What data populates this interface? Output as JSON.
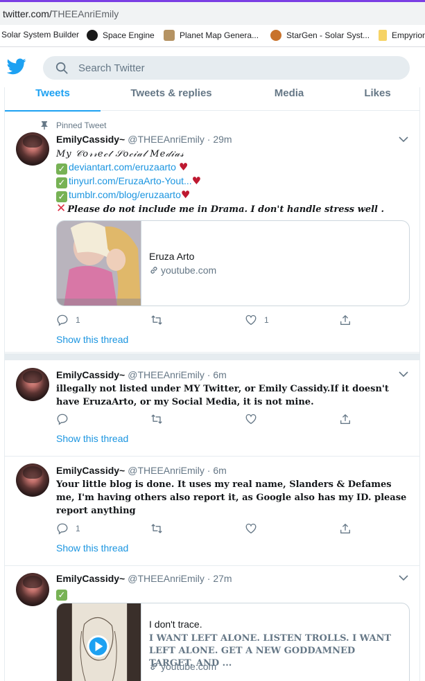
{
  "browser": {
    "url_host": "twitter.com/",
    "url_path": "THEEAnriEmily",
    "bookmarks": [
      {
        "label": "Solar System Builder",
        "icon": "none"
      },
      {
        "label": "Space Engine",
        "icon": "space-engine-icon",
        "color": "#1a1a1a"
      },
      {
        "label": "Planet Map Genera...",
        "icon": "planet-map-icon",
        "color": "#8a6a3a"
      },
      {
        "label": "StarGen - Solar Syst...",
        "icon": "stargen-icon",
        "color": "#c8722b"
      },
      {
        "label": "Empyrion",
        "icon": "folder-icon",
        "color": "#f6d365"
      }
    ]
  },
  "twitter": {
    "search_placeholder": "Search Twitter",
    "brand_color": "#1da1f2",
    "tabs": [
      {
        "label": "Tweets",
        "active": true
      },
      {
        "label": "Tweets & replies",
        "active": false
      },
      {
        "label": "Media",
        "active": false
      },
      {
        "label": "Likes",
        "active": false
      }
    ],
    "tweets": [
      {
        "pinned_label": "Pinned Tweet",
        "name": "EmilyCassidy~",
        "handle": "@THEEAnriEmily",
        "time": "· 29m",
        "line1": "𝑀𝑦 𝒞𝑜𝓇𝓇𝑒𝒸𝓉 𝒮𝑜𝒸𝒾𝒶𝓁 𝑀𝑒𝒹𝒾𝒶𝓈",
        "links": [
          "deviantart.com/eruzaarto",
          "tinyurl.com/EruzaArto-Yout...",
          "tumblr.com/blog/eruzaarto"
        ],
        "warning": "Please do not include me in Drama. I don't handle stress well .",
        "card": {
          "title": "Eruza Arto",
          "domain": "youtube.com"
        },
        "reply_count": "1",
        "like_count": "1",
        "show_thread": "Show this thread"
      },
      {
        "name": "EmilyCassidy~",
        "handle": "@THEEAnriEmily",
        "time": "· 6m",
        "text": "illegally not listed under MY Twitter, or Emily Cassidy.If it doesn't have EruzaArto, or my Social Media, it is not mine.",
        "show_thread": "Show this thread"
      },
      {
        "name": "EmilyCassidy~",
        "handle": "@THEEAnriEmily",
        "time": "· 6m",
        "text": "Your little blog is done. It uses my real name, Slanders & Defames me, I'm having others also report it, as  Google also has my ID. please report anything",
        "reply_count": "1",
        "show_thread": "Show this thread"
      },
      {
        "name": "EmilyCassidy~",
        "handle": "@THEEAnriEmily",
        "time": "· 27m",
        "card": {
          "title": "I don't trace.",
          "description": "I WANT LEFT ALONE. LISTEN TROLLS. I WANT LEFT ALONE. GET A NEW GODDAMNED TARGET. AND ...",
          "domain": "youtube.com"
        }
      }
    ]
  }
}
